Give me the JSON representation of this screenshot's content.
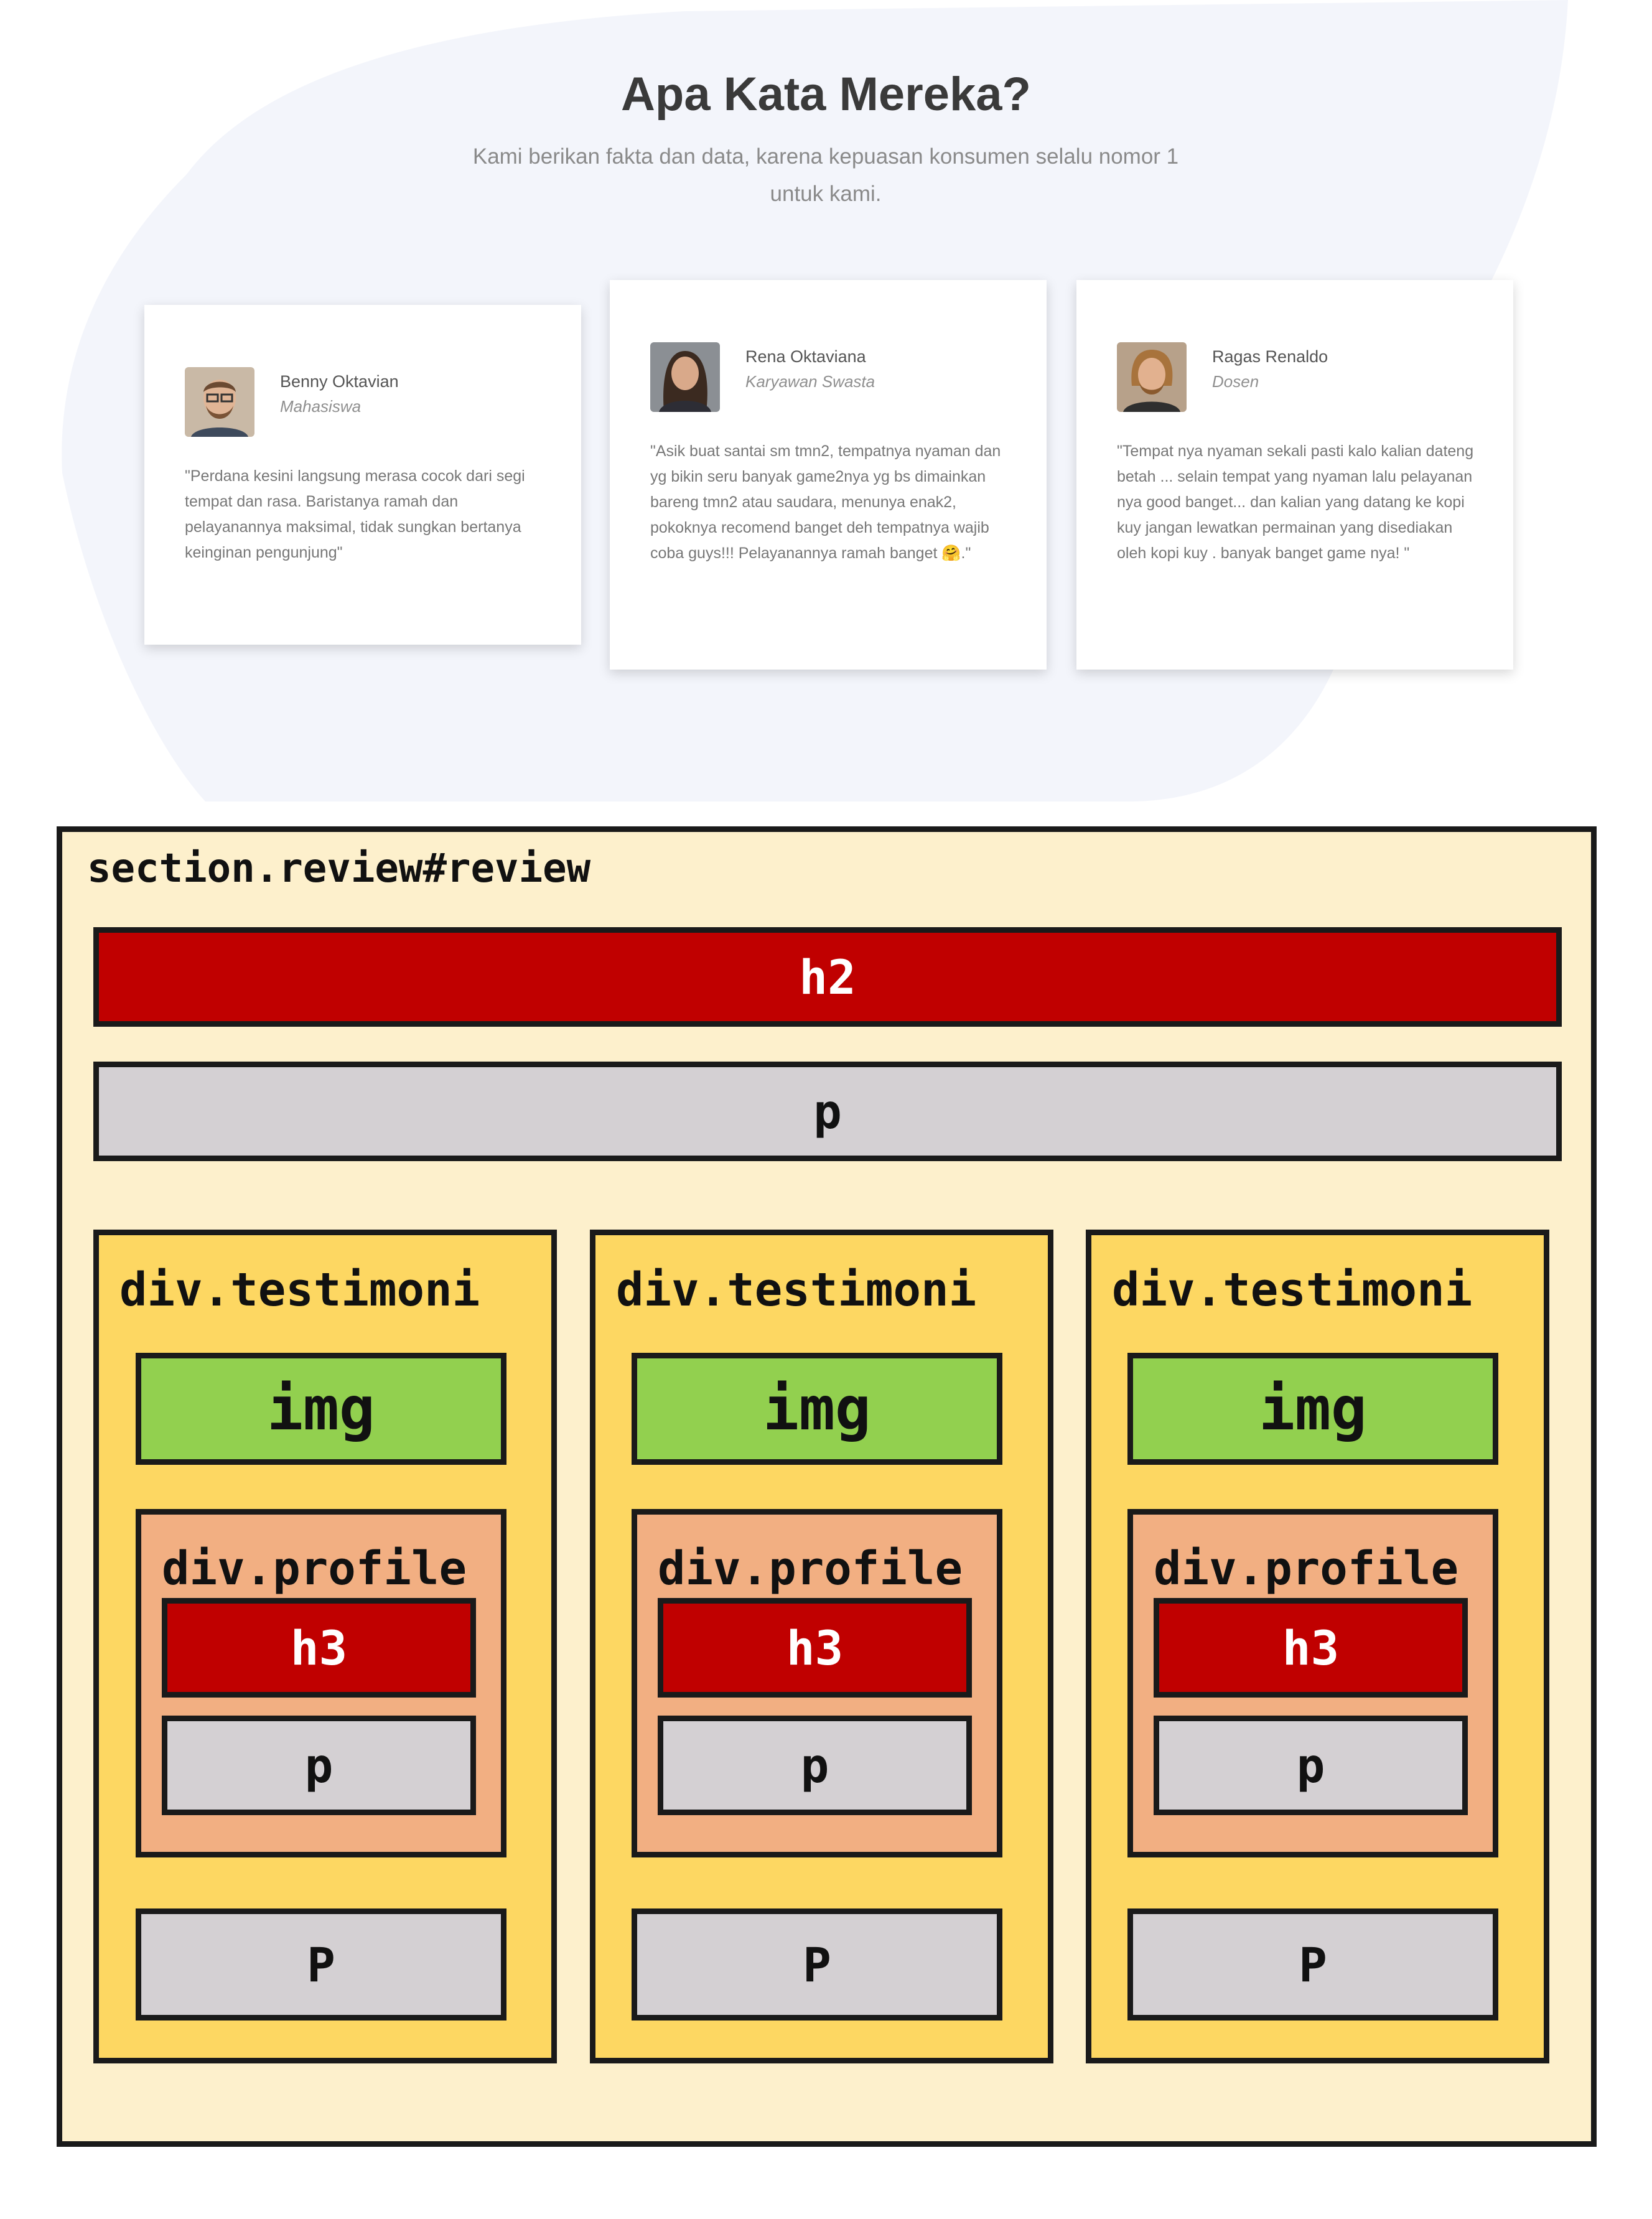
{
  "page": {
    "title": "Apa Kata Mereka?",
    "subtitle": "Kami berikan fakta dan data, karena kepuasan konsumen selalu nomor 1 untuk kami."
  },
  "testimonials": [
    {
      "name": "Benny Oktavian",
      "role": "Mahasiswa",
      "quote": "\"Perdana kesini langsung merasa cocok dari segi tempat dan rasa. Baristanya ramah dan pelayanannya maksimal, tidak sungkan bertanya keinginan pengunjung\""
    },
    {
      "name": "Rena Oktaviana",
      "role": "Karyawan Swasta",
      "quote": "\"Asik buat santai sm tmn2, tempatnya nyaman dan yg bikin seru banyak game2nya yg bs dimainkan bareng tmn2 atau saudara, menunya enak2, pokoknya recomend banget deh tempatnya wajib coba guys!!! Pelayanannya ramah banget 🤗.\""
    },
    {
      "name": "Ragas Renaldo",
      "role": "Dosen",
      "quote": "\"Tempat nya nyaman sekali pasti kalo kalian dateng betah ... selain tempat yang nyaman lalu pelayanan nya good banget... dan kalian yang datang ke kopi kuy jangan lewatkan permainan yang disediakan oleh kopi kuy . banyak banget game nya! \""
    }
  ],
  "colors": {
    "blob": "#f3f5fb",
    "section": "#fdf0cc",
    "heading": "#c00000",
    "paragraph": "#d4d0d3",
    "testimoni": "#fdd762",
    "img": "#92d04f",
    "profile": "#f2af82"
  },
  "diagram": {
    "section_label": "section.review#review",
    "h2_label": "h2",
    "p_label": "p",
    "columns": [
      {
        "label": "div.testimoni",
        "img": "img",
        "profile": "div.profile",
        "h3": "h3",
        "p": "p",
        "P": "P"
      },
      {
        "label": "div.testimoni",
        "img": "img",
        "profile": "div.profile",
        "h3": "h3",
        "p": "p",
        "P": "P"
      },
      {
        "label": "div.testimoni",
        "img": "img",
        "profile": "div.profile",
        "h3": "h3",
        "p": "p",
        "P": "P"
      }
    ]
  }
}
